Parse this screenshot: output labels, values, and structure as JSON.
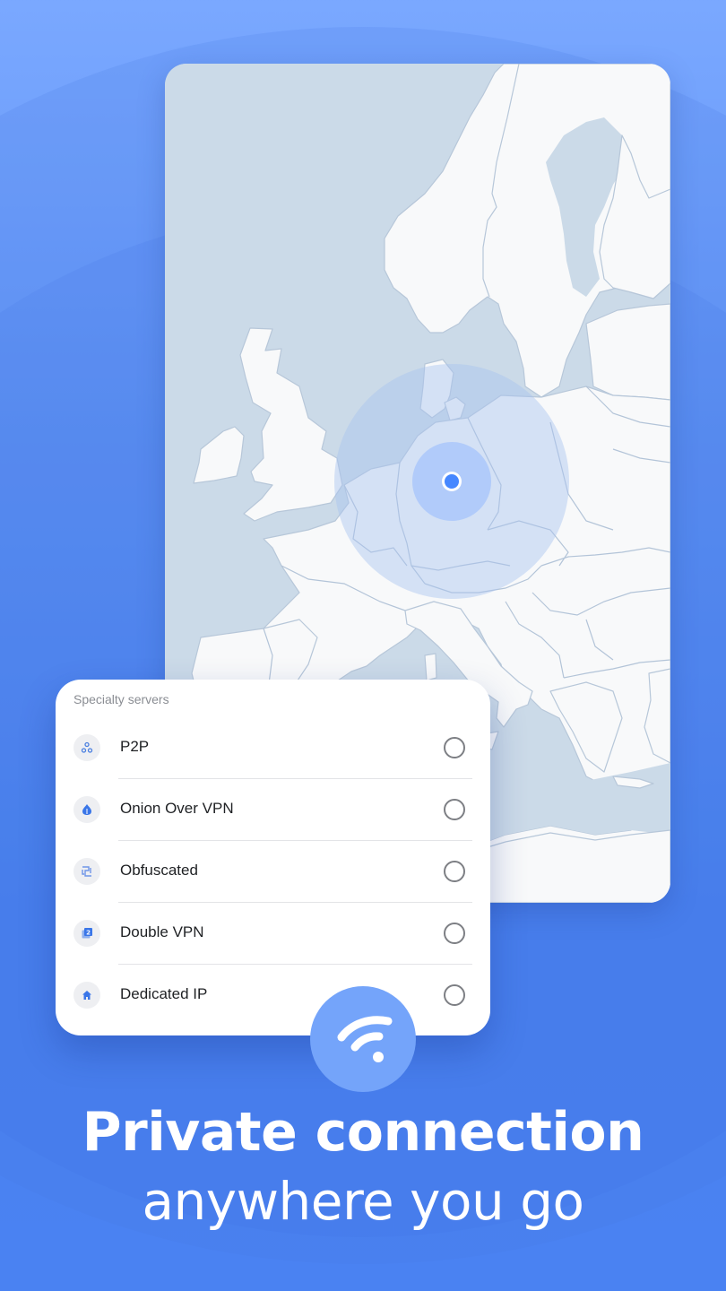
{
  "colors": {
    "accent": "#4687ff",
    "background_top": "#7aa8ff",
    "background_bottom": "#4a82f2",
    "map_sea": "#cbdae8",
    "map_land": "#f8f9fa",
    "wifi_badge": "#74a4fa"
  },
  "map": {
    "region": "Europe",
    "connected_location_marker": "Germany"
  },
  "specialty_servers": {
    "title": "Specialty servers",
    "items": [
      {
        "label": "P2P",
        "icon": "p2p-icon",
        "selected": false
      },
      {
        "label": "Onion Over VPN",
        "icon": "onion-icon",
        "selected": false
      },
      {
        "label": "Obfuscated",
        "icon": "obfuscated-icon",
        "selected": false
      },
      {
        "label": "Double VPN",
        "icon": "double-vpn-icon",
        "selected": false
      },
      {
        "label": "Dedicated IP",
        "icon": "home-icon",
        "selected": false
      }
    ]
  },
  "badge": {
    "icon": "wifi-icon"
  },
  "headline": {
    "line1": "Private connection",
    "line2": "anywhere you go"
  }
}
